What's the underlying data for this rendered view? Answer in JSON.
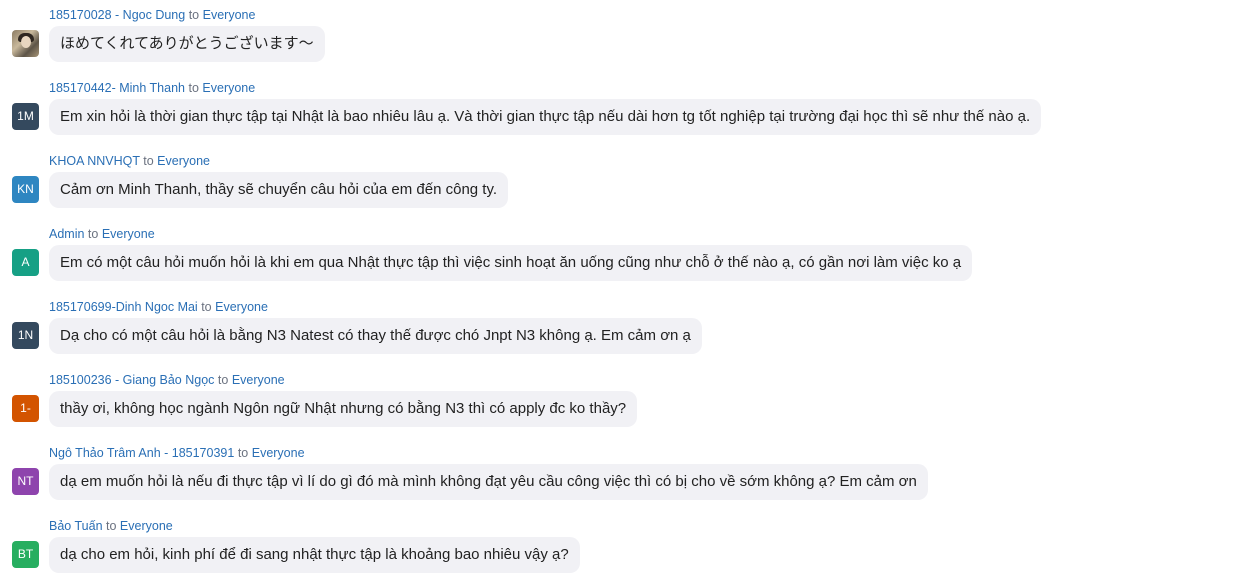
{
  "messages": [
    {
      "sender": "185170028 - Ngoc Dung",
      "to_word": "to",
      "recipient": "Everyone",
      "avatar": {
        "kind": "photo",
        "initials": "",
        "color": "#8a7a62"
      },
      "text": "ほめてくれてありがとうございます〜"
    },
    {
      "sender": "185170442- Minh Thanh",
      "to_word": "to",
      "recipient": "Everyone",
      "avatar": {
        "kind": "initials",
        "initials": "1M",
        "color": "#34495e"
      },
      "text": "Em xin hỏi là thời gian thực tập tại Nhật là bao nhiêu lâu ạ. Và thời gian thực tập nếu dài hơn tg tốt nghiệp tại trường đại học thì sẽ như thế nào ạ."
    },
    {
      "sender": "KHOA NNVHQT",
      "to_word": "to",
      "recipient": "Everyone",
      "avatar": {
        "kind": "initials",
        "initials": "KN",
        "color": "#2e86c1"
      },
      "text": "Cảm ơn Minh Thanh, thầy sẽ chuyển câu hỏi của em đến công ty."
    },
    {
      "sender": "Admin",
      "to_word": "to",
      "recipient": "Everyone",
      "avatar": {
        "kind": "initials",
        "initials": "A",
        "color": "#16a085"
      },
      "text": "Em có một câu hỏi muốn hỏi là khi em qua Nhật thực tập thì việc sinh hoạt ăn uống cũng như chỗ ở thế nào ạ, có gần nơi làm việc ko ạ"
    },
    {
      "sender": "185170699-Dinh Ngoc Mai",
      "to_word": "to",
      "recipient": "Everyone",
      "avatar": {
        "kind": "initials",
        "initials": "1N",
        "color": "#34495e"
      },
      "text": "Dạ cho có một câu hỏi là bằng N3 Natest có thay thế được chó Jnpt N3 không ạ. Em cảm ơn ạ"
    },
    {
      "sender": "185100236 - Giang Bảo Ngọc",
      "to_word": "to",
      "recipient": "Everyone",
      "avatar": {
        "kind": "initials",
        "initials": "1-",
        "color": "#d35400"
      },
      "text": "thầy ơi, không học ngành Ngôn ngữ Nhật nhưng có bằng N3 thì có apply đc ko thầy?"
    },
    {
      "sender": "Ngô Thảo Trâm Anh - 185170391",
      "to_word": "to",
      "recipient": "Everyone",
      "avatar": {
        "kind": "initials",
        "initials": "NT",
        "color": "#8e44ad"
      },
      "text": "dạ em muốn hỏi là nếu đi thực tập vì lí do gì đó mà mình không đạt yêu cầu công việc thì có bị cho về sớm không ạ? Em cảm ơn"
    },
    {
      "sender": "Bảo Tuấn",
      "to_word": "to",
      "recipient": "Everyone",
      "avatar": {
        "kind": "initials",
        "initials": "BT",
        "color": "#27ae60"
      },
      "text": "dạ cho em hỏi, kinh phí để đi sang nhật thực tập là khoảng bao nhiêu vậy ạ?"
    }
  ]
}
